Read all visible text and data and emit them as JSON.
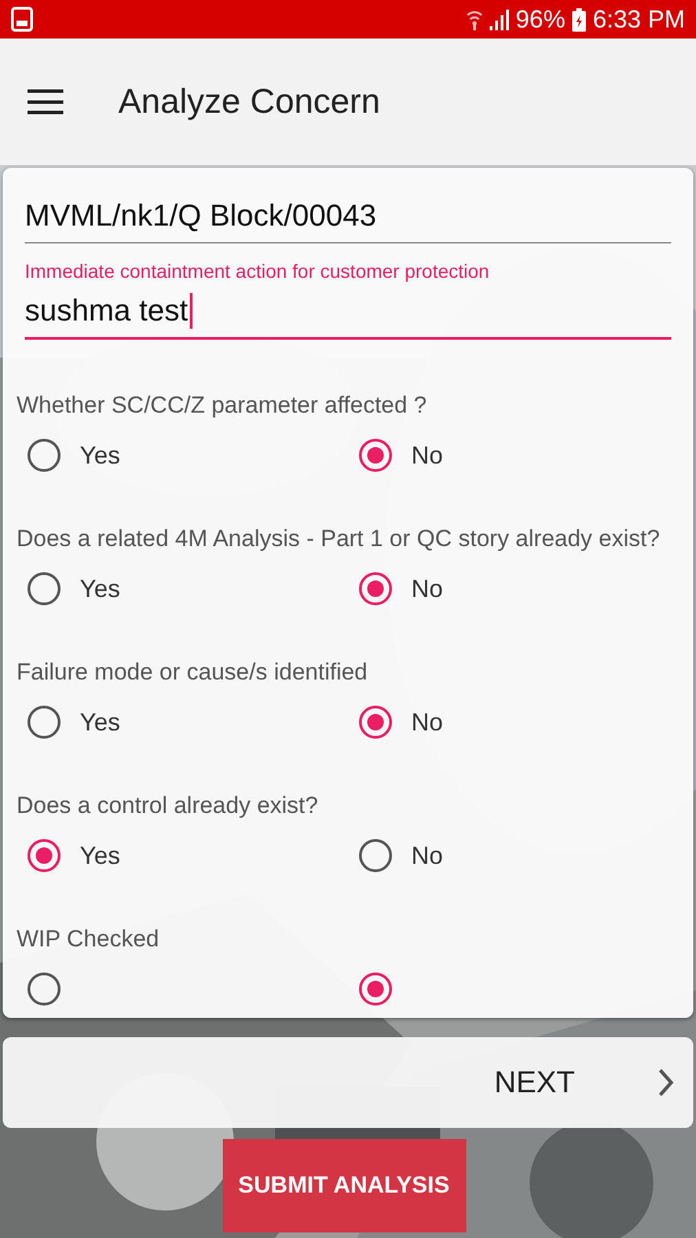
{
  "status_bar": {
    "battery": "96%",
    "time": "6:33 PM"
  },
  "toolbar": {
    "title": "Analyze Concern"
  },
  "form": {
    "fields": [
      {
        "value": "MVML/nk1/Q Block/00043",
        "focused": false
      },
      {
        "label": "Immediate containtment action for customer protection",
        "value": "sushma test",
        "focused": true
      }
    ],
    "questions": [
      {
        "text": "Whether SC/CC/Z parameter affected ?",
        "options": [
          {
            "label": "Yes",
            "selected": false
          },
          {
            "label": "No",
            "selected": true
          }
        ]
      },
      {
        "text": "Does a related 4M Analysis - Part 1 or QC story already exist?",
        "options": [
          {
            "label": "Yes",
            "selected": false
          },
          {
            "label": "No",
            "selected": true
          }
        ]
      },
      {
        "text": "Failure mode or cause/s identified",
        "options": [
          {
            "label": "Yes",
            "selected": false
          },
          {
            "label": "No",
            "selected": true
          }
        ]
      },
      {
        "text": "Does a control already exist?",
        "options": [
          {
            "label": "Yes",
            "selected": true
          },
          {
            "label": "No",
            "selected": false
          }
        ]
      },
      {
        "text": "WIP Checked",
        "options": [
          {
            "selected": false
          },
          {
            "selected": true
          }
        ]
      }
    ]
  },
  "next_button": {
    "label": "NEXT"
  },
  "submit_button": {
    "label": "SUBMIT ANALYSIS"
  }
}
